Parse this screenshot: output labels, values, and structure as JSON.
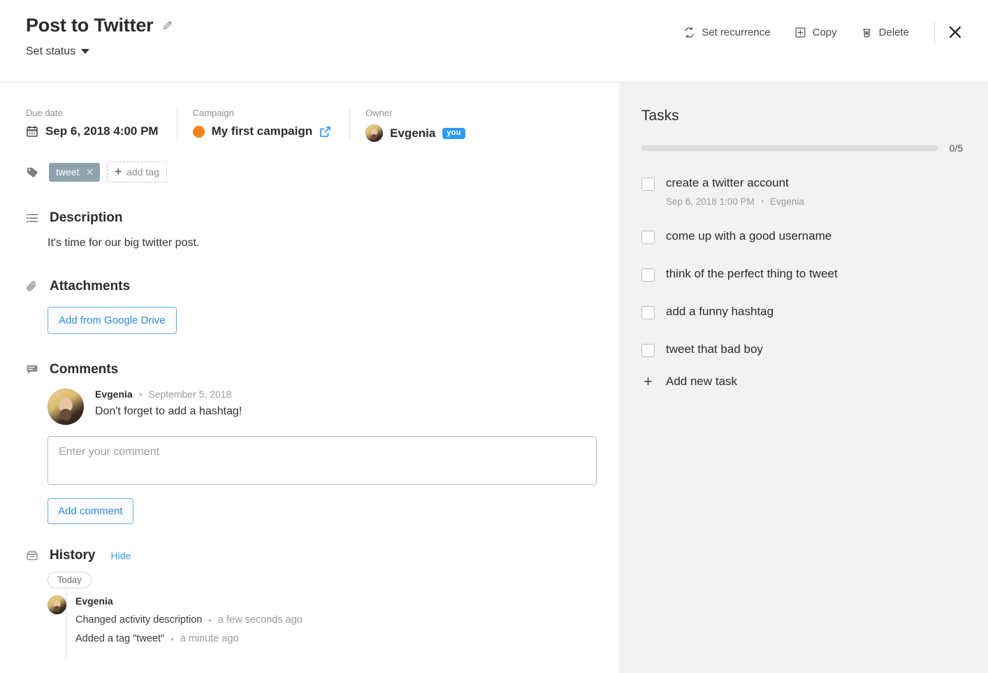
{
  "header": {
    "title": "Post to Twitter",
    "edit_icon": "pencil-icon",
    "status_label": "Set status",
    "actions": [
      {
        "label": "Set recurrence",
        "icon": "recurrence-icon"
      },
      {
        "label": "Copy",
        "icon": "copy-icon"
      },
      {
        "label": "Delete",
        "icon": "trash-icon"
      }
    ],
    "close_icon": "close-icon"
  },
  "meta": {
    "due_date": {
      "label": "Due date",
      "value": "Sep 6, 2018 4:00 PM",
      "icon": "calendar-icon"
    },
    "campaign": {
      "label": "Campaign",
      "value": "My first campaign",
      "dot_color": "#f7821b",
      "link_icon": "external-link-icon"
    },
    "owner": {
      "label": "Owner",
      "value": "Evgenia",
      "badge": "you",
      "badge_color": "#2e9bf0"
    }
  },
  "tags": {
    "icon": "tag-icon",
    "items": [
      {
        "label": "tweet",
        "remove_icon": "close-icon"
      }
    ],
    "add_label": "add tag"
  },
  "description": {
    "icon": "list-icon",
    "title": "Description",
    "text": "It's time for our big twitter post."
  },
  "attachments": {
    "icon": "paperclip-icon",
    "title": "Attachments",
    "button_label": "Add from Google Drive"
  },
  "comments": {
    "icon": "comment-icon",
    "title": "Comments",
    "items": [
      {
        "author": "Evgenia",
        "date": "September 5, 2018",
        "text": "Don't forget to add a hashtag!"
      }
    ],
    "input_placeholder": "Enter your comment",
    "input_value": "",
    "submit_label": "Add comment"
  },
  "history": {
    "icon": "archive-icon",
    "title": "History",
    "toggle_label": "Hide",
    "day_pill": "Today",
    "entries": [
      {
        "author": "Evgenia",
        "lines": [
          {
            "text": "Changed activity description",
            "time": "a few seconds ago"
          },
          {
            "text": "Added a tag \"tweet\"",
            "time": "a minute ago"
          }
        ]
      }
    ]
  },
  "tasks": {
    "title": "Tasks",
    "progress_count": "0/5",
    "progress_percent": 0,
    "items": [
      {
        "label": "create a twitter account",
        "checked": false,
        "due": "Sep 6, 2018 1:00 PM",
        "assignee": "Evgenia"
      },
      {
        "label": "come up with a good username",
        "checked": false
      },
      {
        "label": "think of the perfect thing to tweet",
        "checked": false
      },
      {
        "label": "add a funny hashtag",
        "checked": false
      },
      {
        "label": "tweet that bad boy",
        "checked": false
      }
    ],
    "add_label": "Add new task"
  }
}
